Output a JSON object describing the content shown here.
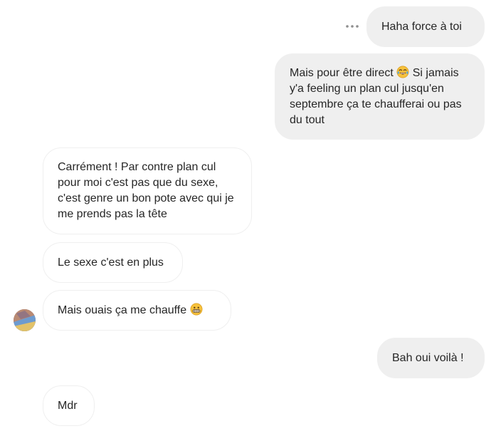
{
  "messages": [
    {
      "id": "m1",
      "direction": "sent",
      "text": "Haha force à toi"
    },
    {
      "id": "m2",
      "direction": "sent",
      "text_a": "Mais pour être direct ",
      "emoji": "tears-of-joy-emoji",
      "text_b": " Si jamais y'a feeling un plan cul jusqu'en septembre ça te chaufferai ou pas du tout"
    },
    {
      "id": "m3",
      "direction": "received",
      "text": "Carrément ! Par contre plan cul pour moi c'est pas que du sexe, c'est genre un bon pote avec qui je me prends pas la tête"
    },
    {
      "id": "m4",
      "direction": "received",
      "text": "Le sexe c'est en plus"
    },
    {
      "id": "m5",
      "direction": "received",
      "text_a": "Mais ouais ça me chauffe ",
      "emoji": "grimacing-grin-emoji"
    },
    {
      "id": "m6",
      "direction": "sent",
      "text": "Bah oui voilà !"
    },
    {
      "id": "m7",
      "direction": "received",
      "text": "Mdr"
    }
  ],
  "icons": {
    "more": "more-options-icon",
    "avatar": "contact-avatar"
  },
  "colors": {
    "sent_bubble": "#efefef",
    "received_border": "#efefef",
    "text": "#262626",
    "background": "#ffffff",
    "emoji_yellow": "#f7c23c"
  }
}
